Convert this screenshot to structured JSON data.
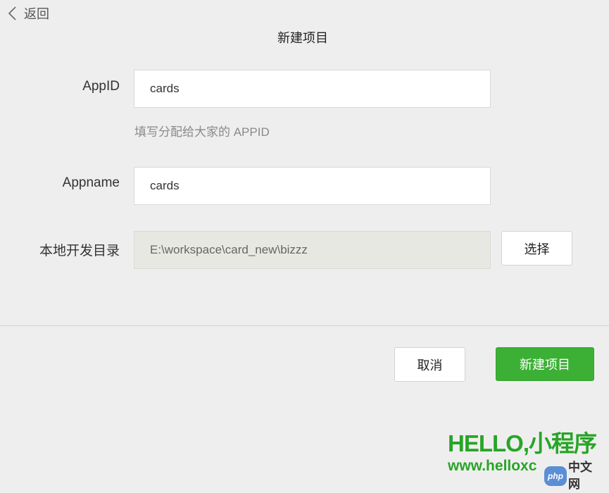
{
  "nav": {
    "back_label": "返回"
  },
  "page": {
    "title": "新建项目"
  },
  "form": {
    "appid_label": "AppID",
    "appid_value": "cards",
    "appid_hint": "填写分配给大家的 APPID",
    "appname_label": "Appname",
    "appname_value": "cards",
    "dir_label": "本地开发目录",
    "dir_value": "E:\\workspace\\card_new\\bizzz",
    "choose_label": "选择"
  },
  "footer": {
    "cancel_label": "取消",
    "create_label": "新建项目"
  },
  "watermark": {
    "title": "HELLO,小程序",
    "url": "www.helloxc",
    "badge_php": "php",
    "badge_cn": "中文网"
  },
  "colors": {
    "background": "#efeeee",
    "primary_green": "#3cb035",
    "watermark_green": "#27a527"
  },
  "icons": {
    "back": "chevron-left-icon"
  }
}
